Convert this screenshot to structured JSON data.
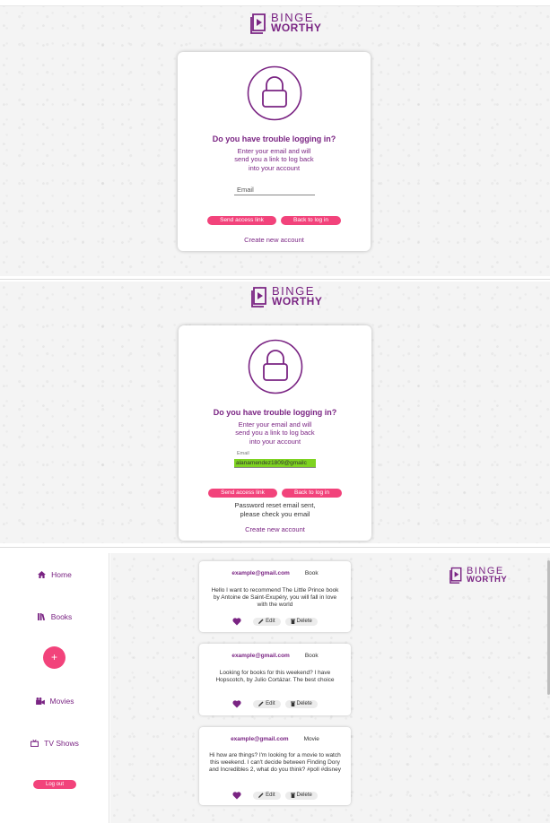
{
  "logo": {
    "line1": "BINGE",
    "line2": "WORTHY"
  },
  "recovery": {
    "title": "Do you have trouble logging in?",
    "subtitle": [
      "Enter your email and will",
      "send you a link to log back",
      "into your account"
    ],
    "email_placeholder": "Email",
    "email_label": "Email",
    "email_value": "alanamendez1809@gmailc",
    "send_button": "Send access link",
    "back_button": "Back to log in",
    "create_link": "Create new account",
    "reset_message": [
      "Password reset email sent,",
      "please check you email"
    ]
  },
  "sidebar": {
    "home": "Home",
    "books": "Books",
    "add": "+",
    "movies": "Movies",
    "tv_shows": "TV Shows",
    "logout": "Log out"
  },
  "posts": [
    {
      "email": "example@gmail.com",
      "type": "Book",
      "text": "Hello I want to recommend The Little Prince book by Antoine de Saint-Exupéry, you will fall in love with the world"
    },
    {
      "email": "example@gmail.com",
      "type": "Book",
      "text": "Looking for books for this weekend? I have Hopscotch, by Julio Cortázar. The best choice"
    },
    {
      "email": "example@gmail.com",
      "type": "Movie",
      "text": "Hi how are things? I'm looking for a movie to watch this weekend. I can't decide between Finding Dory and Incredibles 2, what do you think? #poll #disney"
    }
  ],
  "post_actions": {
    "edit": "Edit",
    "delete": "Delete"
  },
  "colors": {
    "brand_purple": "#7a2483",
    "accent_pink": "#f2437b",
    "highlight_green": "#7ed321"
  }
}
